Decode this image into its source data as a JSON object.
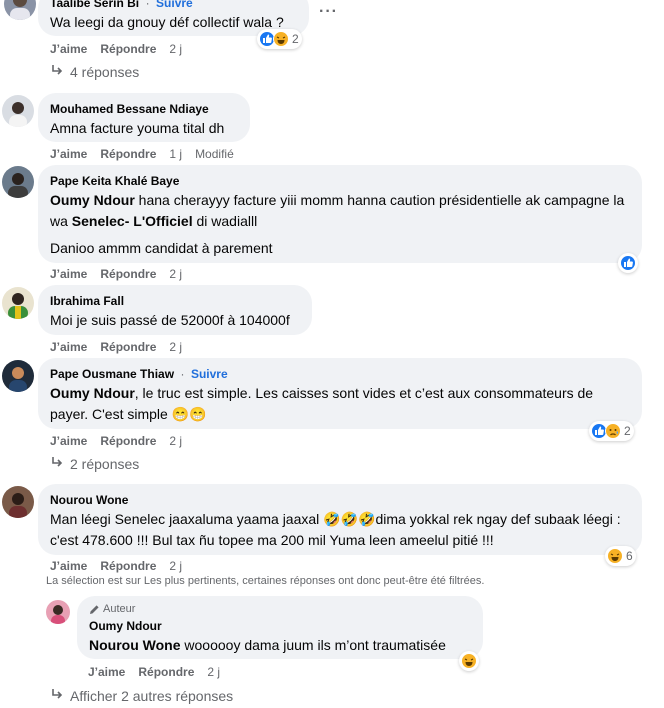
{
  "follow_label": "Suivre",
  "like_label": "J’aime",
  "reply_label": "Répondre",
  "comments": [
    {
      "author": "Taalibé Serin Bi",
      "text": "Wa leegi da gnouy déf collectif wala ?",
      "time": "2 j",
      "reactions": [
        "like",
        "haha"
      ],
      "reaction_count": "2",
      "replies": "4 réponses"
    },
    {
      "author": "Mouhamed Bessane Ndiaye",
      "text": "Amna facture youma tital dh",
      "time": "1 j",
      "edited": "Modifié"
    },
    {
      "author": "Pape Keita Khalé Baye",
      "mention": "Oumy Ndour",
      "text_a": " hana cherayyy facture yiii momm hanna caution présidentielle ak campagne la wa ",
      "mention2": "Senelec- L'Officiel",
      "text_b": " di wadialll",
      "text2": "Danioo ammm candidat à parement",
      "time": "2 j",
      "reactions": [
        "like"
      ]
    },
    {
      "author": "Ibrahima Fall",
      "text": "Moi je suis passé de 52000f à 104000f",
      "time": "2 j"
    },
    {
      "author": "Pape Ousmane Thiaw",
      "mention": "Oumy Ndour",
      "text": ", le truc est simple. Les caisses sont vides et c’est aux consommateurs de payer. C'est simple 😁😁",
      "time": "2 j",
      "reactions": [
        "like",
        "sad"
      ],
      "reaction_count": "2",
      "replies": "2 réponses"
    },
    {
      "author": "Nourou Wone",
      "text": "Man léegi Senelec jaaxaluma yaama jaaxal 🤣🤣🤣dima yokkal rek ngay def subaak léegi : c'est 478.600 !!! Bul tax ñu topee ma 200 mil Yuma leen ameelul pitié !!!",
      "time": "2 j",
      "reactions": [
        "haha"
      ],
      "reaction_count": "6"
    }
  ],
  "filter_notice": "La sélection est sur Les plus pertinents, certaines réponses ont donc peut-être été filtrées.",
  "reply": {
    "badge": "Auteur",
    "author": "Oumy Ndour",
    "mention": "Nourou Wone",
    "text": " woooooy dama juum ils m’ont traumatisée",
    "time": "2 j",
    "reactions": [
      "haha"
    ]
  },
  "more_replies": "Afficher 2 autres réponses",
  "colors": {
    "accent": "#216fdb",
    "bubble": "#f0f2f5",
    "meta": "#65676b",
    "like": "#1877f2",
    "haha": "#f7b125"
  }
}
